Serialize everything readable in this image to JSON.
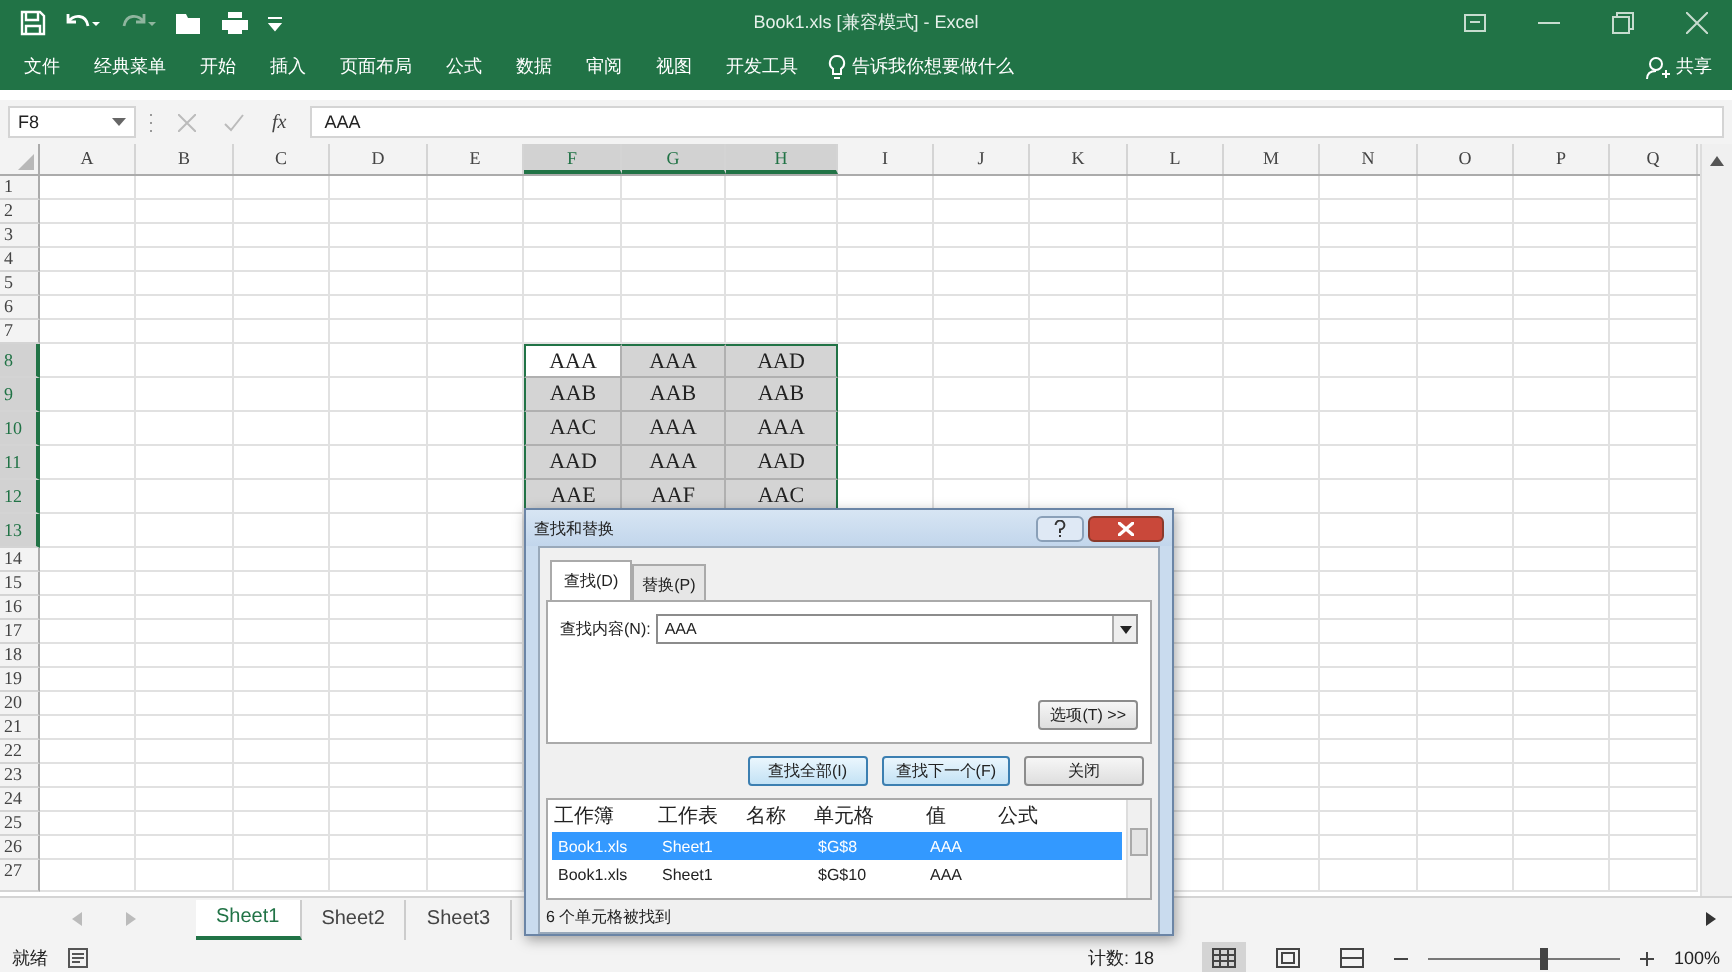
{
  "title_bar": {
    "title": "Book1.xls  [兼容模式]  -  Excel"
  },
  "ribbon": {
    "tabs": [
      "文件",
      "经典菜单",
      "开始",
      "插入",
      "页面布局",
      "公式",
      "数据",
      "审阅",
      "视图",
      "开发工具"
    ],
    "tell_me": "告诉我你想要做什么",
    "share": "共享"
  },
  "formula_bar": {
    "name_box": "F8",
    "function_label": "fx",
    "formula": "AAA"
  },
  "sheet": {
    "columns": [
      {
        "label": "A",
        "selected": false
      },
      {
        "label": "B",
        "selected": false
      },
      {
        "label": "C",
        "selected": false
      },
      {
        "label": "D",
        "selected": false
      },
      {
        "label": "E",
        "selected": false
      },
      {
        "label": "F",
        "selected": true
      },
      {
        "label": "G",
        "selected": true
      },
      {
        "label": "H",
        "selected": true
      },
      {
        "label": "I",
        "selected": false
      },
      {
        "label": "J",
        "selected": false
      },
      {
        "label": "K",
        "selected": false
      },
      {
        "label": "L",
        "selected": false
      },
      {
        "label": "M",
        "selected": false
      },
      {
        "label": "N",
        "selected": false
      },
      {
        "label": "O",
        "selected": false
      },
      {
        "label": "P",
        "selected": false
      },
      {
        "label": "Q",
        "selected": false
      }
    ],
    "rows": [
      {
        "label": "1",
        "selected": false
      },
      {
        "label": "2",
        "selected": false
      },
      {
        "label": "3",
        "selected": false
      },
      {
        "label": "4",
        "selected": false
      },
      {
        "label": "5",
        "selected": false
      },
      {
        "label": "6",
        "selected": false
      },
      {
        "label": "7",
        "selected": false
      },
      {
        "label": "8",
        "selected": true
      },
      {
        "label": "9",
        "selected": true
      },
      {
        "label": "10",
        "selected": true
      },
      {
        "label": "11",
        "selected": true
      },
      {
        "label": "12",
        "selected": true
      },
      {
        "label": "13",
        "selected": true
      },
      {
        "label": "14",
        "selected": false
      },
      {
        "label": "15",
        "selected": false
      },
      {
        "label": "16",
        "selected": false
      },
      {
        "label": "17",
        "selected": false
      },
      {
        "label": "18",
        "selected": false
      },
      {
        "label": "19",
        "selected": false
      },
      {
        "label": "20",
        "selected": false
      },
      {
        "label": "21",
        "selected": false
      },
      {
        "label": "22",
        "selected": false
      },
      {
        "label": "23",
        "selected": false
      },
      {
        "label": "24",
        "selected": false
      },
      {
        "label": "25",
        "selected": false
      },
      {
        "label": "26",
        "selected": false
      },
      {
        "label": "27",
        "selected": false
      }
    ],
    "selection_block": [
      [
        "AAA",
        "AAA",
        "AAD"
      ],
      [
        "AAB",
        "AAB",
        "AAB"
      ],
      [
        "AAC",
        "AAA",
        "AAA"
      ],
      [
        "AAD",
        "AAA",
        "AAD"
      ],
      [
        "AAE",
        "AAF",
        "AAC"
      ]
    ]
  },
  "sheet_tabs": [
    {
      "label": "Sheet1",
      "selected": true
    },
    {
      "label": "Sheet2",
      "selected": false
    },
    {
      "label": "Sheet3",
      "selected": false
    }
  ],
  "status_bar": {
    "ready": "就绪",
    "count": "计数: 18",
    "view_buttons": [
      {
        "kind": "normal",
        "selected": true
      },
      {
        "kind": "page_layout",
        "selected": false
      },
      {
        "kind": "page_break",
        "selected": false
      }
    ],
    "zoom_slider": {
      "level": 0.6
    },
    "zoom": "100%"
  },
  "dialog": {
    "title": "查找和替换",
    "tabs": [
      {
        "label": "查找(D)",
        "selected": true
      },
      {
        "label": "替换(P)",
        "selected": false
      }
    ],
    "find_label": "查找内容(N):",
    "find_value": "AAA",
    "options_button": "选项(T) >>",
    "buttons": [
      {
        "label": "查找全部(I)",
        "highlighted": true
      },
      {
        "label": "查找下一个(F)",
        "highlighted": true
      },
      {
        "label": "关闭",
        "highlighted": false
      }
    ],
    "results": {
      "columns": [
        "工作簿",
        "工作表",
        "名称",
        "单元格",
        "值",
        "公式"
      ],
      "rows": [
        {
          "cells": [
            "Book1.xls",
            "Sheet1",
            "",
            "$G$8",
            "AAA",
            ""
          ],
          "selected": true
        },
        {
          "cells": [
            "Book1.xls",
            "Sheet1",
            "",
            "$G$10",
            "AAA",
            ""
          ],
          "selected": false
        }
      ]
    },
    "status": "6 个单元格被找到"
  }
}
